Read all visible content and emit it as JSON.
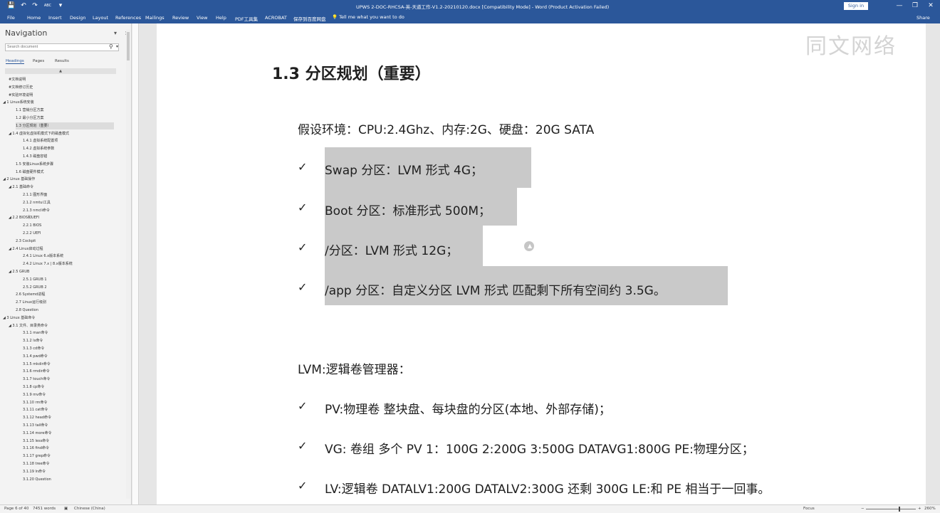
{
  "titlebar": {
    "title": "UPWS 2-DOC-RHCSA-英-天道工作-V1.2-20210120.docx [Compatibility Mode] - Word (Product Activation Failed)",
    "signin": "Sign in",
    "min": "—",
    "restore": "❐",
    "close": "✕",
    "qa_save": "💾",
    "qa_undo": "↶",
    "qa_redo": "↷",
    "qa_spell": "ABC",
    "qa_more": "▾"
  },
  "ribbon": {
    "tabs": [
      "File",
      "Home",
      "Insert",
      "Design",
      "Layout",
      "References",
      "Mailings",
      "Review",
      "View",
      "Help",
      "PDF工具集",
      "ACROBAT",
      "保存到百度网盘"
    ],
    "tellme": "💡 Tell me what you want to do",
    "share": "Share"
  },
  "nav": {
    "title": "Navigation",
    "close": "×",
    "caret": "▾",
    "search_placeholder": "Search document",
    "search_icon": "⚲",
    "search_drop": "▾",
    "tabs": [
      "Headings",
      "Pages",
      "Results"
    ],
    "scroll_up": "▲",
    "items": [
      {
        "label": "#文档说明",
        "level": 1
      },
      {
        "label": "#文档修订历史",
        "level": 1
      },
      {
        "label": "#实验环境说明",
        "level": 1
      },
      {
        "label": "◢ 1 Linux系统安装",
        "level": 0
      },
      {
        "label": "1.1 营销分区方案",
        "level": 2
      },
      {
        "label": "1.2 最小分区方案",
        "level": 2
      },
      {
        "label": "1.3 分区规划（重要）",
        "level": 2,
        "selected": true
      },
      {
        "label": "◢ 1.4 虚拟化虚拟机模式下的磁盘模式",
        "level": 1
      },
      {
        "label": "1.4.1 虚拟系统配置项",
        "level": 3
      },
      {
        "label": "1.4.2 虚拟系统参数",
        "level": 3
      },
      {
        "label": "1.4.3 磁盘容错",
        "level": 3
      },
      {
        "label": "1.5 安装Linux系统步骤",
        "level": 2
      },
      {
        "label": "1.6 磁盘硬件模式",
        "level": 2
      },
      {
        "label": "◢ 2 Linux 基础操作",
        "level": 0
      },
      {
        "label": "◢ 2.1 基础命令",
        "level": 1
      },
      {
        "label": "2.1.1 图形界面",
        "level": 3
      },
      {
        "label": "2.1.2 nmtui工具",
        "level": 3
      },
      {
        "label": "2.1.3 nmcli命令",
        "level": 3
      },
      {
        "label": "◢ 2.2 BIOS和UEFI",
        "level": 1
      },
      {
        "label": "2.2.1 BIOS",
        "level": 3
      },
      {
        "label": "2.2.2 UEFI",
        "level": 3
      },
      {
        "label": "2.3 Cockpit",
        "level": 2
      },
      {
        "label": "◢ 2.4 Linux启动过程",
        "level": 1
      },
      {
        "label": "2.4.1 Linux 6.x版本系统",
        "level": 3
      },
      {
        "label": "2.4.2 Linux 7.x | 8.x版本系统",
        "level": 3
      },
      {
        "label": "◢ 2.5 GRUB",
        "level": 1
      },
      {
        "label": "2.5.1 GRUB 1",
        "level": 3
      },
      {
        "label": "2.5.2 GRUB 2",
        "level": 3
      },
      {
        "label": "2.6 Systemd进程",
        "level": 2
      },
      {
        "label": "2.7 Linux运行级别",
        "level": 2
      },
      {
        "label": "2.8 Question",
        "level": 2
      },
      {
        "label": "◢ 3 Linux 基础命令",
        "level": 0
      },
      {
        "label": "◢ 3.1 文件、目录类命令",
        "level": 1
      },
      {
        "label": "3.1.1 man命令",
        "level": 3
      },
      {
        "label": "3.1.2 ls命令",
        "level": 3
      },
      {
        "label": "3.1.3 cd命令",
        "level": 3
      },
      {
        "label": "3.1.4 pwd命令",
        "level": 3
      },
      {
        "label": "3.1.5 mkdir命令",
        "level": 3
      },
      {
        "label": "3.1.6 rmdir命令",
        "level": 3
      },
      {
        "label": "3.1.7 touch命令",
        "level": 3
      },
      {
        "label": "3.1.8 cp命令",
        "level": 3
      },
      {
        "label": "3.1.9 mv命令",
        "level": 3
      },
      {
        "label": "3.1.10 rm命令",
        "level": 3
      },
      {
        "label": "3.1.11 cat命令",
        "level": 3
      },
      {
        "label": "3.1.12 head命令",
        "level": 3
      },
      {
        "label": "3.1.13 tail命令",
        "level": 3
      },
      {
        "label": "3.1.14 more命令",
        "level": 3
      },
      {
        "label": "3.1.15 less命令",
        "level": 3
      },
      {
        "label": "3.1.16 find命令",
        "level": 3
      },
      {
        "label": "3.1.17 grep命令",
        "level": 3
      },
      {
        "label": "3.1.18 tree命令",
        "level": 3
      },
      {
        "label": "3.1.19 ln命令",
        "level": 3
      },
      {
        "label": "3.1.20 Question",
        "level": 3
      }
    ]
  },
  "doc": {
    "watermark": "同文网络",
    "heading": "1.3  分区规划（重要）",
    "env": "假设环境：CPU:2.4Ghz、内存:2G、硬盘：20G SATA",
    "checkmark": "✓",
    "partitions": [
      "Swap 分区：LVM 形式  4G；",
      "Boot 分区：标准形式 500M；",
      "/分区：LVM 形式 12G；",
      "/app 分区：自定义分区    LVM 形式    匹配剩下所有空间约 3.5G。"
    ],
    "lvm_title": "LVM:逻辑卷管理器：",
    "lvm_items": [
      "PV:物理卷  整块盘、每块盘的分区(本地、外部存储)；",
      "VG: 卷组  多个 PV 1：100G     2:200G     3:500G     DATAVG1:800G     PE:物理分区；",
      "LV:逻辑卷  DATALV1:200G     DATALV2:300G     还剩 300G     LE:和 PE 相当于一回事。"
    ]
  },
  "status": {
    "page": "Page 6 of 40",
    "words": "7451 words",
    "proof_icon": "▣",
    "language": "Chinese (China)",
    "focus": "Focus",
    "zoom_minus": "−",
    "zoom_plus": "+",
    "zoom": "260%"
  },
  "colors": {
    "accent": "#2b579a",
    "highlight": "#c9c9c9"
  }
}
